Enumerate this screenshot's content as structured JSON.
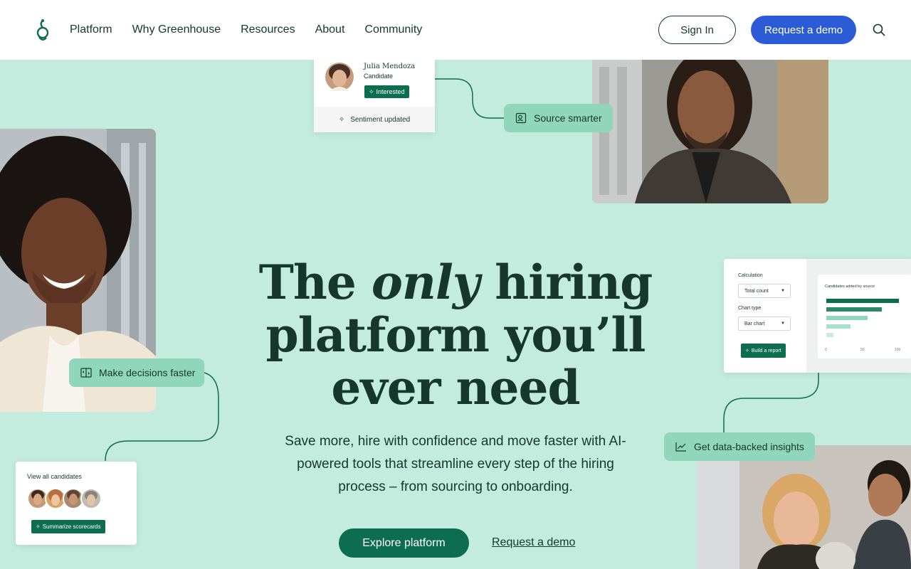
{
  "header": {
    "nav": [
      "Platform",
      "Why Greenhouse",
      "Resources",
      "About",
      "Community"
    ],
    "sign_in": "Sign In",
    "request_demo": "Request a demo"
  },
  "hero": {
    "headline_line1_a": "The ",
    "headline_line1_em": "only",
    "headline_line1_b": " hiring",
    "headline_line2": "platform you’ll",
    "headline_line3": "ever need",
    "subtext": "Save more, hire with confidence and move faster with AI-powered tools that streamline every step of the hiring process – from sourcing to onboarding.",
    "primary_cta": "Explore platform",
    "secondary_cta": "Request a demo"
  },
  "candidate_card": {
    "name": "Julia Mendoza",
    "role": "Candidate",
    "tag": "Interested",
    "footer": "Sentiment updated"
  },
  "pills": {
    "source": "Source smarter",
    "decisions": "Make decisions faster",
    "insights": "Get data-backed insights"
  },
  "report_card": {
    "calc_label": "Calculation",
    "calc_value": "Total count",
    "chart_type_label": "Chart type",
    "chart_type_value": "Bar chart",
    "build_button": "Build a report",
    "chart_title": "Candidates added by source",
    "axis_ticks": [
      "0",
      "50",
      "100"
    ]
  },
  "candidates_card": {
    "title": "View all candidates",
    "button": "Summarize scorecards"
  },
  "colors": {
    "background": "#c3ebde",
    "brand_green": "#0c6e4f",
    "pill_green": "#8fd6bd",
    "demo_blue": "#2b5bd7"
  }
}
